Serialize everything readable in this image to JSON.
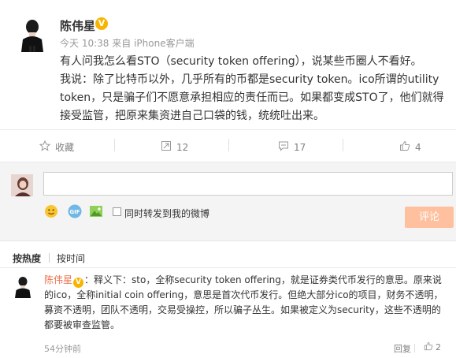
{
  "post": {
    "author": "陈伟星",
    "verified_badge": "V",
    "time": "今天 10:38",
    "source_prefix": "来自",
    "source": "iPhone客户端",
    "paragraphs": [
      "有人问我怎么看STO（security token offering），说某些币圈人不看好。",
      "我说：除了比特币以外，几乎所有的币都是security token。ico所谓的utility token，只是骗子们不愿意承担相应的责任而已。如果都变成STO了，他们就得接受监管，把原来集资进自己口袋的钱，统统吐出来。"
    ]
  },
  "actions": {
    "favorite_label": "收藏",
    "repost_count": "12",
    "comment_count": "17",
    "like_count": "4"
  },
  "composer": {
    "input_value": "",
    "repost_checkbox_label": "同时转发到我的微博",
    "repost_checked": false,
    "submit_label": "评论"
  },
  "sort": {
    "hot_label": "按热度",
    "time_label": "按时间"
  },
  "comments": [
    {
      "author": "陈伟星",
      "badge": "V",
      "text": "：释义下：sto，全称security token offering，就是证券类代币发行的意思。原来说的ico，全称initial coin offering，意思是首次代币发行。但绝大部分ico的项目，财务不透明，募资不透明，团队不透明，交易受操控，所以骗子丛生。如果被定义为security，这些不透明的都要被审查监管。",
      "time": "54分钟前",
      "reply_label": "回复",
      "like_count": "2"
    }
  ],
  "colors": {
    "accent": "#eb7350",
    "badge": "#f7b500",
    "submit_bg": "#ffc09f"
  }
}
